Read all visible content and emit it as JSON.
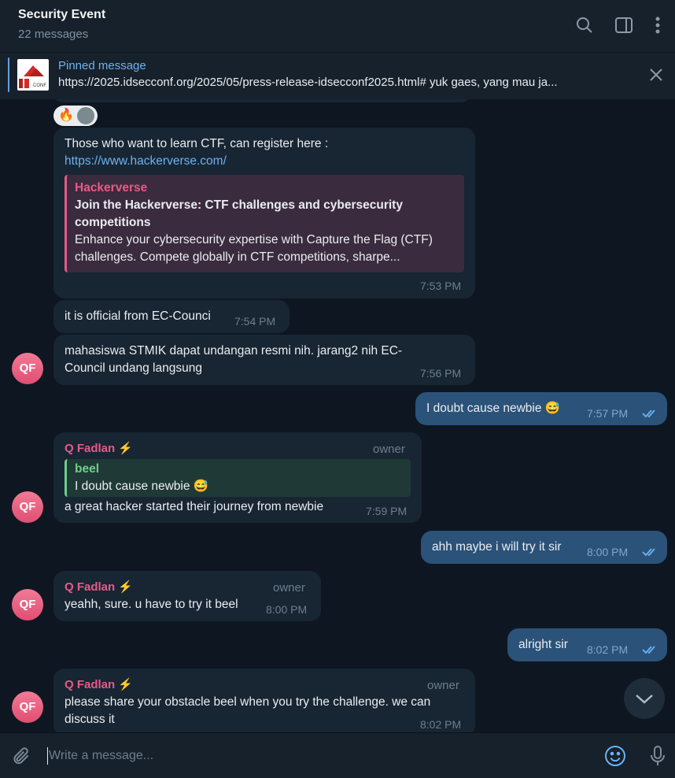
{
  "header": {
    "title": "Security Event",
    "subtitle": "22 messages"
  },
  "pinned": {
    "title": "Pinned message",
    "text": "https://2025.idsecconf.org/2025/05/press-release-idsecconf2025.html#  yuk gaes, yang mau ja...",
    "logo_text": "CONF"
  },
  "reactions": [
    "🔥"
  ],
  "messages": [
    {
      "text": "Those who want to learn CTF, can register here :",
      "link": "https://www.hackerverse.com/",
      "preview": {
        "site": "Hackerverse",
        "title": "Join the Hackerverse: CTF challenges and cybersecurity competitions",
        "description": "Enhance your cybersecurity expertise with Capture the Flag (CTF) challenges. Compete globally in CTF competitions, sharpe..."
      },
      "time": "7:53 PM"
    },
    {
      "text": "it is official from EC-Counci",
      "time": "7:54 PM"
    },
    {
      "avatar": "QF",
      "text": "mahasiswa STMIK dapat undangan resmi nih. jarang2 nih EC-Council undang langsung",
      "time": "7:56 PM"
    },
    {
      "text": "I doubt cause newbie 😅",
      "time": "7:57 PM",
      "outgoing": true
    },
    {
      "avatar": "QF",
      "sender": "Q Fadlan ⚡",
      "role": "owner",
      "reply": {
        "name": "beel",
        "text": "I doubt cause newbie 😅"
      },
      "text": "a great hacker started their journey from newbie",
      "time": "7:59 PM"
    },
    {
      "text": "ahh maybe i will try it sir",
      "time": "8:00 PM",
      "outgoing": true
    },
    {
      "avatar": "QF",
      "sender": "Q Fadlan ⚡",
      "role": "owner",
      "text": "yeahh, sure. u have to try it beel",
      "time": "8:00 PM"
    },
    {
      "text": "alright sir",
      "time": "8:02 PM",
      "outgoing": true
    },
    {
      "avatar": "QF",
      "sender": "Q Fadlan ⚡",
      "role": "owner",
      "text": "please share your obstacle beel when you try the challenge. we can discuss it",
      "time": "8:02 PM"
    }
  ],
  "input": {
    "placeholder": "Write a message..."
  },
  "colors": {
    "background": "#0e1621",
    "header": "#17212b",
    "incoming_bubble": "#182533",
    "outgoing_bubble": "#2b5278",
    "accent": "#6ab3f3",
    "sender_name": "#e85a87",
    "reply_name": "#6fcf8a"
  }
}
